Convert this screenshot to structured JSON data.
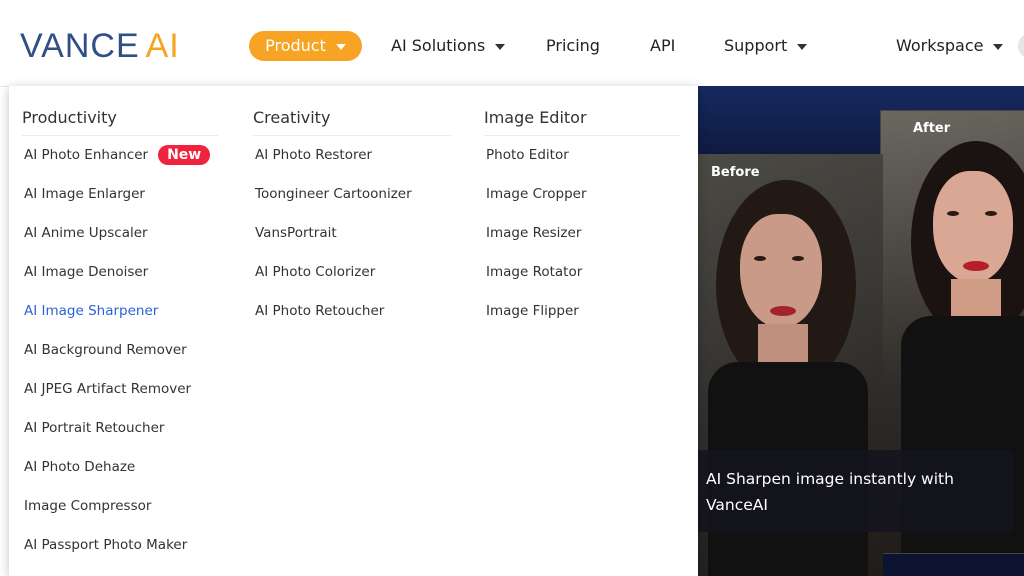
{
  "brand": {
    "name_part1": "VANCE",
    "name_part2": "AI",
    "primary_color": "#2f4f86",
    "accent_color": "#f7a323"
  },
  "nav": {
    "items": [
      {
        "label": "Product",
        "has_caret": true,
        "active": true
      },
      {
        "label": "AI Solutions",
        "has_caret": true
      },
      {
        "label": "Pricing",
        "has_caret": false
      },
      {
        "label": "API",
        "has_caret": false
      },
      {
        "label": "Support",
        "has_caret": true
      },
      {
        "label": "Workspace",
        "has_caret": true
      }
    ]
  },
  "dropdown": {
    "columns": [
      {
        "title": "Productivity",
        "items": [
          {
            "label": "AI Photo Enhancer",
            "badge": "New"
          },
          {
            "label": "AI Image Enlarger"
          },
          {
            "label": "AI Anime Upscaler"
          },
          {
            "label": "AI Image Denoiser"
          },
          {
            "label": "AI Image Sharpener",
            "active": true
          },
          {
            "label": "AI Background Remover"
          },
          {
            "label": "AI JPEG Artifact Remover"
          },
          {
            "label": "AI Portrait Retoucher"
          },
          {
            "label": "AI Photo Dehaze"
          },
          {
            "label": "Image Compressor"
          },
          {
            "label": "AI Passport Photo Maker"
          }
        ]
      },
      {
        "title": "Creativity",
        "items": [
          {
            "label": "AI Photo Restorer"
          },
          {
            "label": "Toongineer Cartoonizer"
          },
          {
            "label": "VansPortrait"
          },
          {
            "label": "AI Photo Colorizer"
          },
          {
            "label": "AI Photo Retoucher"
          }
        ]
      },
      {
        "title": "Image Editor",
        "items": [
          {
            "label": "Photo Editor"
          },
          {
            "label": "Image Cropper"
          },
          {
            "label": "Image Resizer"
          },
          {
            "label": "Image Rotator"
          },
          {
            "label": "Image Flipper"
          }
        ]
      }
    ]
  },
  "hero": {
    "before_label": "Before",
    "after_label": "After",
    "caption": "AI Sharpen image instantly with VanceAI"
  },
  "colors": {
    "badge_new": "#f0233f",
    "active_link": "#2a63d6"
  }
}
